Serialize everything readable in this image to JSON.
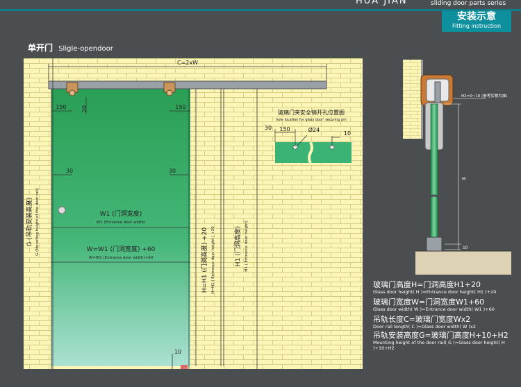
{
  "header": {
    "brand": "HUA JIAN",
    "series": "sliding door parts series",
    "badge_cn": "安装示意",
    "badge_en": "Fitting instruction"
  },
  "title": {
    "cn": "单开门",
    "en": "Sligle-opendoor"
  },
  "dims": {
    "rail_length": "C=2xW",
    "offset_150_left": "150",
    "offset_20": "20",
    "offset_150_right": "150",
    "margin_30_left": "30",
    "margin_30_right": "30",
    "bottom_gap": "10",
    "w1_cn": "W1 (门洞宽度)",
    "w1_en": "W1 (Entrance door width)",
    "w_cn": "W=W1 (门洞宽度) +60",
    "w_en": "W=W1 (Entrance door width)+60",
    "g_cn": "G (吊轨安装高度)",
    "g_en": "G (Mounting height of the door rail)",
    "h_cn": "H=H1 (门洞高度) +20",
    "h_en": "H=H1 ( Entrance door height ) +20",
    "h1_cn": "H1 (门洞高度)",
    "h1_en": "H1 ( Entrance door height)"
  },
  "pin_detail": {
    "title_cn": "玻璃门夹安全销开孔位置图",
    "title_en": "hole location for glass door' securing pin",
    "d30": "30",
    "d150": "150",
    "hole": "Ø24",
    "d10": "10"
  },
  "side_view": {
    "h2_note": "H2=0~10 (参考实物为准)",
    "h_label": "H",
    "gap10": "10"
  },
  "formulas": [
    {
      "cn": "玻璃门高度H=门洞高度H1+20",
      "en": "Glass door height( H )=Entrance door height( H1 )+20"
    },
    {
      "cn": "玻璃门宽度W=门洞宽度W1+60",
      "en": "Glass door width( W )=Entrance door width( W1 )+60"
    },
    {
      "cn": "吊轨长度C=玻璃门宽度Wx2",
      "en": "Door rail length( C )=Glass door width( W )x2"
    },
    {
      "cn": "吊轨安装高度G=玻璃门高度H+10+H2",
      "en": "Mounting height of the door rail( G )=Glass door height( H )+10+H2"
    }
  ],
  "colors": {
    "wall": "#fbf5b8",
    "brick_line": "#d9cf83",
    "glass": "#2fa866",
    "accent": "#0e7f8e"
  }
}
